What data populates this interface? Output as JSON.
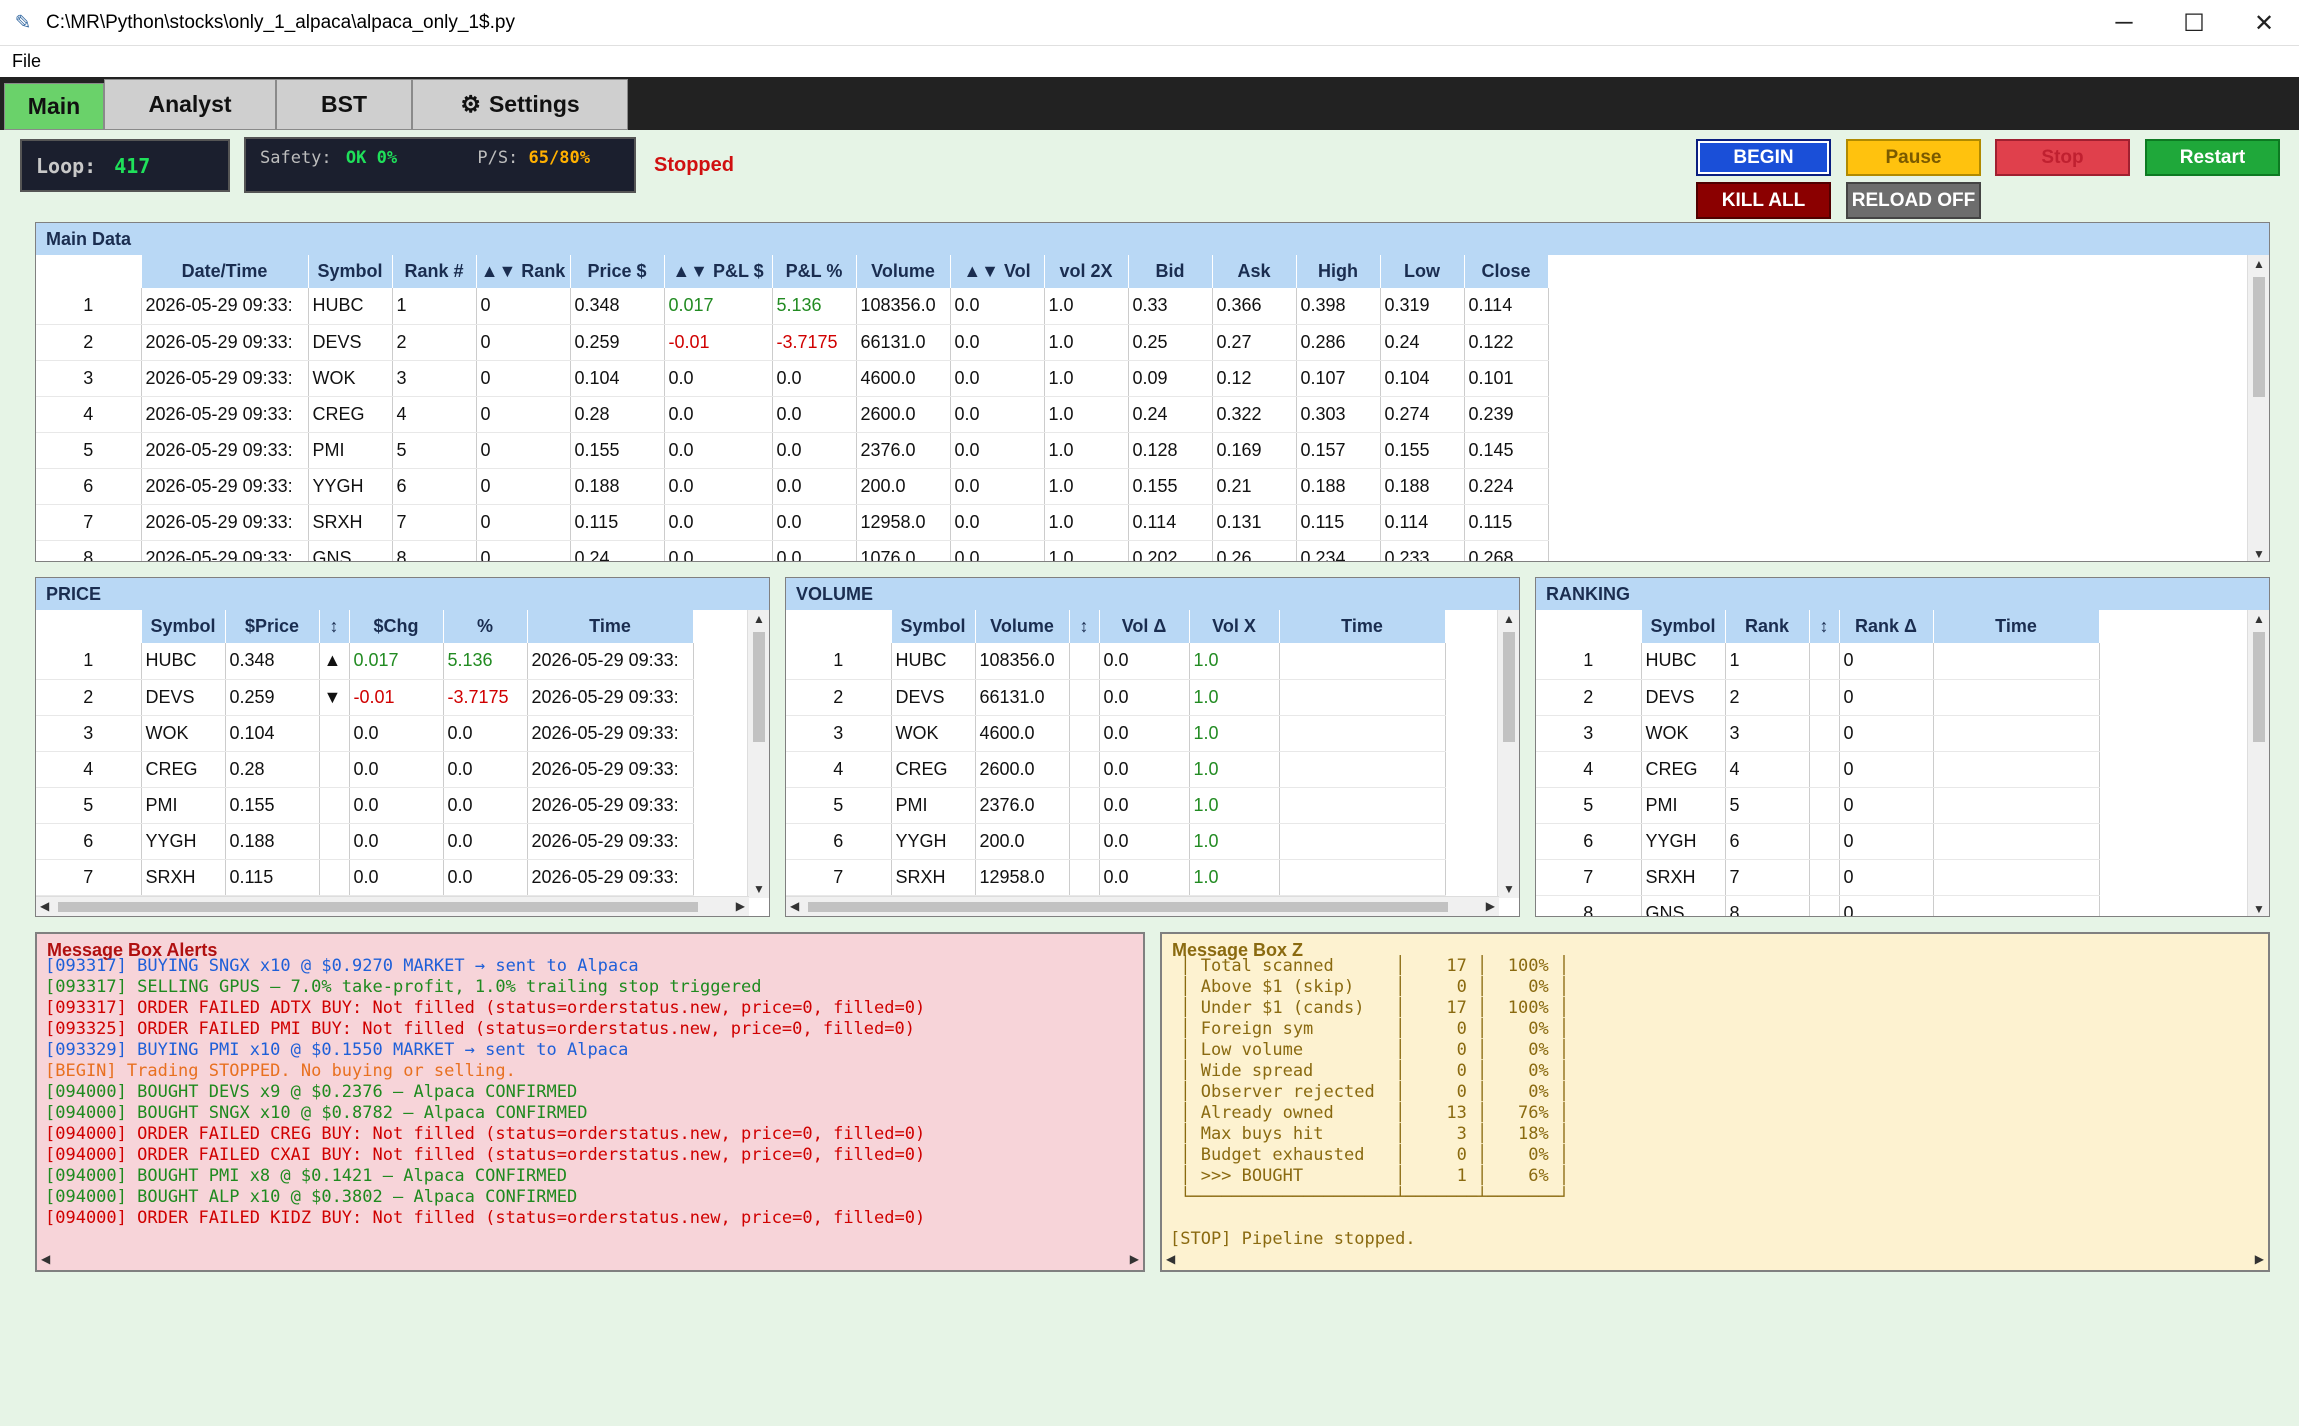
{
  "window": {
    "title": "C:\\MR\\Python\\stocks\\only_1_alpaca\\alpaca_only_1$.py",
    "minimize": "─",
    "maximize": "☐",
    "close": "✕"
  },
  "menu": {
    "file": "File"
  },
  "tabs": [
    {
      "label": "Main"
    },
    {
      "label": "Analyst"
    },
    {
      "label": "BST"
    },
    {
      "label": "Settings",
      "icon": "gear-icon"
    }
  ],
  "status": {
    "loop_label": "Loop:",
    "loop_value": "417",
    "safety_label": "Safety:",
    "safety_value": "OK 0%",
    "ps_label": "P/S:",
    "ps_value": "65/80%",
    "state": "Stopped"
  },
  "controls": {
    "begin": "BEGIN",
    "pause": "Pause",
    "stop": "Stop",
    "restart": "Restart",
    "kill_all": "KILL ALL",
    "reload": "RELOAD OFF"
  },
  "main_data": {
    "title": "Main Data",
    "columns": [
      "Date/Time",
      "Symbol",
      "Rank #",
      "▲▼ Rank",
      "Price $",
      "▲▼ P&L $",
      "P&L %",
      "Volume",
      "▲▼ Vol",
      "vol 2X",
      "Bid",
      "Ask",
      "High",
      "Low",
      "Close"
    ],
    "rows": [
      [
        "1",
        "2026-05-29 09:33:",
        "HUBC",
        "1",
        "0",
        "0.348",
        "0.017",
        "5.136",
        "108356.0",
        "0.0",
        "1.0",
        "0.33",
        "0.366",
        "0.398",
        "0.319",
        "0.114"
      ],
      [
        "2",
        "2026-05-29 09:33:",
        "DEVS",
        "2",
        "0",
        "0.259",
        "-0.01",
        "-3.7175",
        "66131.0",
        "0.0",
        "1.0",
        "0.25",
        "0.27",
        "0.286",
        "0.24",
        "0.122"
      ],
      [
        "3",
        "2026-05-29 09:33:",
        "WOK",
        "3",
        "0",
        "0.104",
        "0.0",
        "0.0",
        "4600.0",
        "0.0",
        "1.0",
        "0.09",
        "0.12",
        "0.107",
        "0.104",
        "0.101"
      ],
      [
        "4",
        "2026-05-29 09:33:",
        "CREG",
        "4",
        "0",
        "0.28",
        "0.0",
        "0.0",
        "2600.0",
        "0.0",
        "1.0",
        "0.24",
        "0.322",
        "0.303",
        "0.274",
        "0.239"
      ],
      [
        "5",
        "2026-05-29 09:33:",
        "PMI",
        "5",
        "0",
        "0.155",
        "0.0",
        "0.0",
        "2376.0",
        "0.0",
        "1.0",
        "0.128",
        "0.169",
        "0.157",
        "0.155",
        "0.145"
      ],
      [
        "6",
        "2026-05-29 09:33:",
        "YYGH",
        "6",
        "0",
        "0.188",
        "0.0",
        "0.0",
        "200.0",
        "0.0",
        "1.0",
        "0.155",
        "0.21",
        "0.188",
        "0.188",
        "0.224"
      ],
      [
        "7",
        "2026-05-29 09:33:",
        "SRXH",
        "7",
        "0",
        "0.115",
        "0.0",
        "0.0",
        "12958.0",
        "0.0",
        "1.0",
        "0.114",
        "0.131",
        "0.115",
        "0.114",
        "0.115"
      ],
      [
        "8",
        "2026-05-29 09:33:",
        "GNS",
        "8",
        "0",
        "0.24",
        "0.0",
        "0.0",
        "1076.0",
        "0.0",
        "1.0",
        "0.202",
        "0.26",
        "0.234",
        "0.233",
        "0.268"
      ]
    ]
  },
  "price": {
    "title": "PRICE",
    "columns": [
      "Symbol",
      "$Price",
      "↕",
      "$Chg",
      "%",
      "Time"
    ],
    "rows": [
      [
        "1",
        "HUBC",
        "0.348",
        "▲",
        "0.017",
        "5.136",
        "2026-05-29 09:33:"
      ],
      [
        "2",
        "DEVS",
        "0.259",
        "▼",
        "-0.01",
        "-3.7175",
        "2026-05-29 09:33:"
      ],
      [
        "3",
        "WOK",
        "0.104",
        "",
        "0.0",
        "0.0",
        "2026-05-29 09:33:"
      ],
      [
        "4",
        "CREG",
        "0.28",
        "",
        "0.0",
        "0.0",
        "2026-05-29 09:33:"
      ],
      [
        "5",
        "PMI",
        "0.155",
        "",
        "0.0",
        "0.0",
        "2026-05-29 09:33:"
      ],
      [
        "6",
        "YYGH",
        "0.188",
        "",
        "0.0",
        "0.0",
        "2026-05-29 09:33:"
      ],
      [
        "7",
        "SRXH",
        "0.115",
        "",
        "0.0",
        "0.0",
        "2026-05-29 09:33:"
      ]
    ]
  },
  "volume": {
    "title": "VOLUME",
    "columns": [
      "Symbol",
      "Volume",
      "↕",
      "Vol Δ",
      "Vol X",
      "Time"
    ],
    "rows": [
      [
        "1",
        "HUBC",
        "108356.0",
        "",
        "0.0",
        "1.0",
        ""
      ],
      [
        "2",
        "DEVS",
        "66131.0",
        "",
        "0.0",
        "1.0",
        ""
      ],
      [
        "3",
        "WOK",
        "4600.0",
        "",
        "0.0",
        "1.0",
        ""
      ],
      [
        "4",
        "CREG",
        "2600.0",
        "",
        "0.0",
        "1.0",
        ""
      ],
      [
        "5",
        "PMI",
        "2376.0",
        "",
        "0.0",
        "1.0",
        ""
      ],
      [
        "6",
        "YYGH",
        "200.0",
        "",
        "0.0",
        "1.0",
        ""
      ],
      [
        "7",
        "SRXH",
        "12958.0",
        "",
        "0.0",
        "1.0",
        ""
      ]
    ]
  },
  "ranking": {
    "title": "RANKING",
    "columns": [
      "Symbol",
      "Rank",
      "↕",
      "Rank Δ",
      "Time"
    ],
    "rows": [
      [
        "1",
        "HUBC",
        "1",
        "",
        "0",
        ""
      ],
      [
        "2",
        "DEVS",
        "2",
        "",
        "0",
        ""
      ],
      [
        "3",
        "WOK",
        "3",
        "",
        "0",
        ""
      ],
      [
        "4",
        "CREG",
        "4",
        "",
        "0",
        ""
      ],
      [
        "5",
        "PMI",
        "5",
        "",
        "0",
        ""
      ],
      [
        "6",
        "YYGH",
        "6",
        "",
        "0",
        ""
      ],
      [
        "7",
        "SRXH",
        "7",
        "",
        "0",
        ""
      ],
      [
        "8",
        "GNS",
        "8",
        "",
        "0",
        ""
      ]
    ]
  },
  "alerts": {
    "title": "Message Box Alerts",
    "lines": [
      {
        "text": "[093317] BUYING SNGX x10 @ $0.9270 MARKET → sent to Alpaca",
        "color": "#1e5fd8"
      },
      {
        "text": "[093317] SELLING GPUS — 7.0% take-profit, 1.0% trailing stop triggered",
        "color": "#1f8a1f"
      },
      {
        "text": "[093317] ORDER FAILED ADTX BUY: Not filled (status=orderstatus.new, price=0, filled=0)",
        "color": "#d00000"
      },
      {
        "text": "[093325] ORDER FAILED PMI BUY: Not filled (status=orderstatus.new, price=0, filled=0)",
        "color": "#d00000"
      },
      {
        "text": "[093329] BUYING PMI x10 @ $0.1550 MARKET → sent to Alpaca",
        "color": "#1e5fd8"
      },
      {
        "text": "[BEGIN] Trading STOPPED. No buying or selling.",
        "color": "#e87020"
      },
      {
        "text": "[094000] BOUGHT DEVS x9 @ $0.2376 — Alpaca CONFIRMED",
        "color": "#1f8a1f"
      },
      {
        "text": "[094000] BOUGHT SNGX x10 @ $0.8782 — Alpaca CONFIRMED",
        "color": "#1f8a1f"
      },
      {
        "text": "[094000] ORDER FAILED CREG BUY: Not filled (status=orderstatus.new, price=0, filled=0)",
        "color": "#d00000"
      },
      {
        "text": "[094000] ORDER FAILED CXAI BUY: Not filled (status=orderstatus.new, price=0, filled=0)",
        "color": "#d00000"
      },
      {
        "text": "[094000] BOUGHT PMI x8 @ $0.1421 — Alpaca CONFIRMED",
        "color": "#1f8a1f"
      },
      {
        "text": "[094000] BOUGHT ALP x10 @ $0.3802 — Alpaca CONFIRMED",
        "color": "#1f8a1f"
      },
      {
        "text": "[094000] ORDER FAILED KIDZ BUY: Not filled (status=orderstatus.new, price=0, filled=0)",
        "color": "#d00000"
      }
    ]
  },
  "msgz": {
    "title": "Message Box Z",
    "lines": [
      " │ Total scanned      │    17 │  100% │",
      " │ Above $1 (skip)    │     0 │    0% │",
      " │ Under $1 (cands)   │    17 │  100% │",
      " │ Foreign sym        │     0 │    0% │",
      " │ Low volume         │     0 │    0% │",
      " │ Wide spread        │     0 │    0% │",
      " │ Observer rejected  │     0 │    0% │",
      " │ Already owned      │    13 │   76% │",
      " │ Max buys hit       │     3 │   18% │",
      " │ Budget exhausted   │     0 │    0% │",
      " │ >>> BOUGHT         │     1 │    6% │",
      " └────────────────────┴───────┴───────┘",
      "",
      "[STOP] Pipeline stopped."
    ]
  },
  "colors": {
    "tab_active": "#6ad26a",
    "header_blue": "#b9d8f5",
    "alerts_bg": "#f7d4d9",
    "z_bg": "#fdf2d0",
    "app_bg": "#e6f4e6"
  }
}
